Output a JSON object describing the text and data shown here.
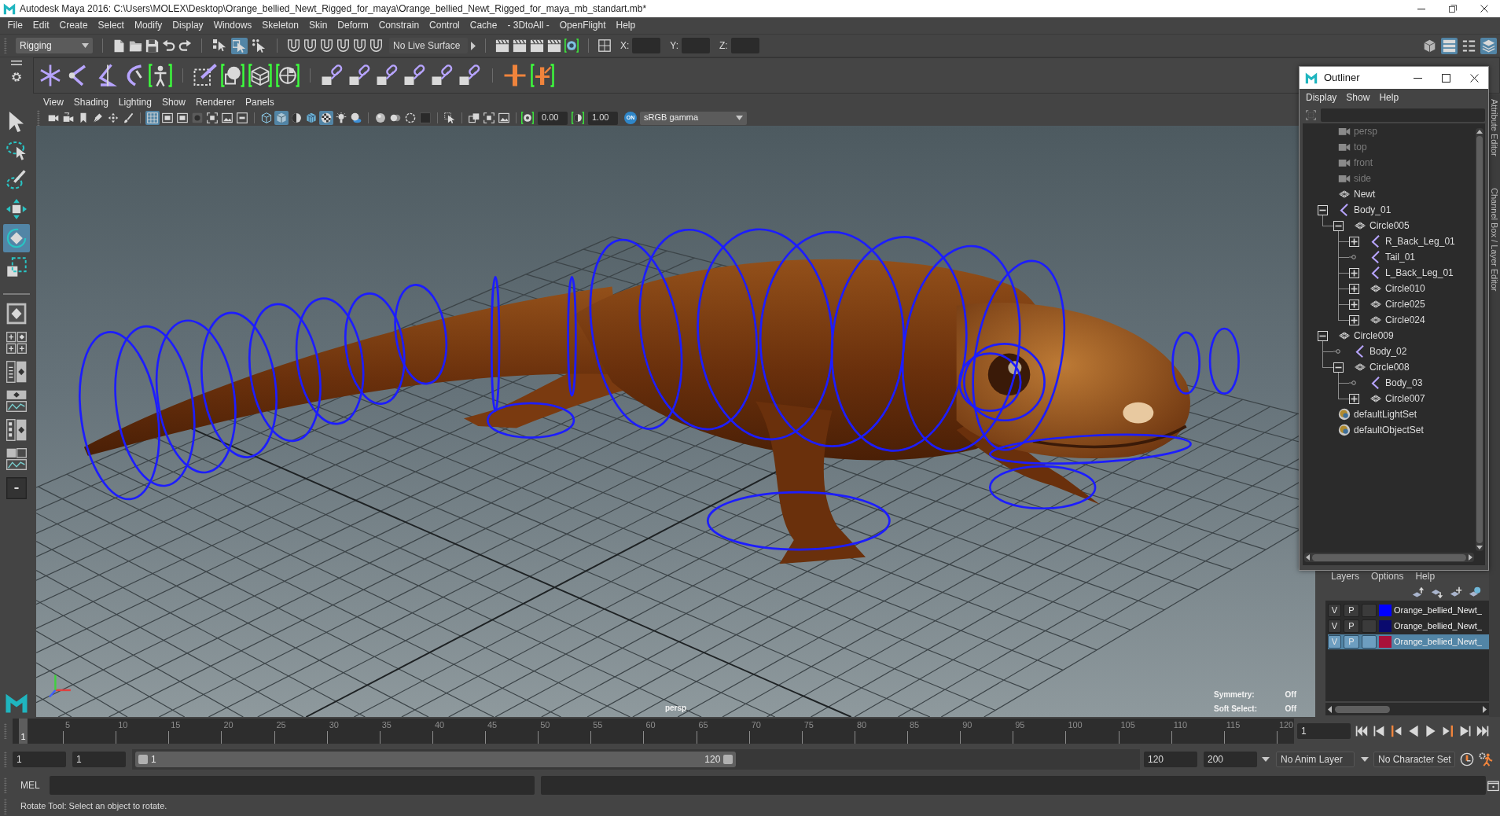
{
  "window": {
    "title": "Autodesk Maya 2016: C:\\Users\\MOLEX\\Desktop\\Orange_bellied_Newt_Rigged_for_maya\\Orange_bellied_Newt_Rigged_for_maya_mb_standart.mb*"
  },
  "menu_bar": [
    "File",
    "Edit",
    "Create",
    "Select",
    "Modify",
    "Display",
    "Windows",
    "Skeleton",
    "Skin",
    "Deform",
    "Constrain",
    "Control",
    "Cache",
    "- 3DtoAll -",
    "OpenFlight",
    "Help"
  ],
  "status_line": {
    "menu_set": "Rigging",
    "select_modes": [
      {
        "selected": false
      },
      {
        "selected": true
      },
      {
        "selected": false
      }
    ],
    "live_surface": "No Live Surface",
    "coordinate_fields": [
      {
        "label": "X:"
      },
      {
        "label": "Y:"
      },
      {
        "label": "Z:"
      }
    ],
    "panel_toggles": [
      {
        "on": false
      },
      {
        "on": true
      },
      {
        "on": false
      },
      {
        "on": true
      }
    ]
  },
  "tool_box": {
    "tools": [
      {
        "selected": false
      },
      {
        "selected": false
      },
      {
        "selected": false
      },
      {
        "selected": false
      },
      {
        "selected": true
      },
      {
        "selected": false
      }
    ]
  },
  "viewport": {
    "menus": [
      "View",
      "Shading",
      "Lighting",
      "Show",
      "Renderer",
      "Panels"
    ],
    "display_toggles": [
      {
        "on": false
      },
      {
        "on": false
      },
      {
        "on": false
      },
      {
        "on": false
      },
      {
        "on": false
      },
      {
        "on": false
      },
      {
        "on": true
      },
      {
        "on": false
      },
      {
        "on": false
      },
      {
        "on": false
      },
      {
        "on": false
      },
      {
        "on": false
      },
      {
        "on": false
      },
      {
        "on": false
      },
      {
        "on": true
      },
      {
        "on": false
      },
      {
        "on": false
      },
      {
        "on": true
      },
      {
        "on": false
      },
      {
        "on": false
      },
      {
        "on": false
      },
      {
        "on": false
      },
      {
        "on": false
      },
      {
        "on": false
      },
      {
        "on": false
      },
      {
        "on": false
      },
      {
        "on": false
      },
      {
        "on": false
      }
    ],
    "exposure": "0.00",
    "gamma": "1.00",
    "color_management": "ON",
    "color_space": "sRGB gamma",
    "camera": "persp",
    "hud": [
      {
        "label": "Symmetry:",
        "value": "Off"
      },
      {
        "label": "Soft Select:",
        "value": "Off"
      }
    ]
  },
  "outliner": {
    "title": "Outliner",
    "menus": [
      "Display",
      "Show",
      "Help"
    ],
    "items": [
      {
        "name": "persp",
        "kind": "camera",
        "hidden": true,
        "expandable": false
      },
      {
        "name": "top",
        "kind": "camera",
        "hidden": true,
        "expandable": false
      },
      {
        "name": "front",
        "kind": "camera",
        "hidden": true,
        "expandable": false
      },
      {
        "name": "side",
        "kind": "camera",
        "hidden": true,
        "expandable": false
      },
      {
        "name": "Newt",
        "kind": "transform",
        "hidden": false,
        "expandable": false
      },
      {
        "name": "Body_01",
        "kind": "joint",
        "hidden": false,
        "expandable": true,
        "expanded": true,
        "children": [
          {
            "name": "Circle005",
            "kind": "transform",
            "hidden": false,
            "expandable": true,
            "expanded": true,
            "children": [
              {
                "name": "R_Back_Leg_01",
                "kind": "joint",
                "hidden": false,
                "expandable": true,
                "expanded": false
              },
              {
                "name": "Tail_01",
                "kind": "joint",
                "hidden": false,
                "expandable": false
              },
              {
                "name": "L_Back_Leg_01",
                "kind": "joint",
                "hidden": false,
                "expandable": true,
                "expanded": false
              },
              {
                "name": "Circle010",
                "kind": "transform",
                "hidden": false,
                "expandable": true,
                "expanded": false
              },
              {
                "name": "Circle025",
                "kind": "transform",
                "hidden": false,
                "expandable": true,
                "expanded": false
              },
              {
                "name": "Circle024",
                "kind": "transform",
                "hidden": false,
                "expandable": true,
                "expanded": false
              }
            ]
          }
        ]
      },
      {
        "name": "Circle009",
        "kind": "transform",
        "hidden": false,
        "expandable": true,
        "expanded": true,
        "children": [
          {
            "name": "Body_02",
            "kind": "joint",
            "hidden": false,
            "expandable": false
          },
          {
            "name": "Circle008",
            "kind": "transform",
            "hidden": false,
            "expandable": true,
            "expanded": true,
            "children": [
              {
                "name": "Body_03",
                "kind": "joint",
                "hidden": false,
                "expandable": false
              },
              {
                "name": "Circle007",
                "kind": "transform",
                "hidden": false,
                "expandable": true,
                "expanded": false
              }
            ]
          }
        ]
      },
      {
        "name": "defaultLightSet",
        "kind": "set",
        "hidden": false,
        "expandable": false
      },
      {
        "name": "defaultObjectSet",
        "kind": "set",
        "hidden": false,
        "expandable": false
      }
    ]
  },
  "side_tabs": [
    "Attribute Editor",
    "Channel Box / Layer Editor"
  ],
  "layer_editor": {
    "menus": [
      "Layers",
      "Options",
      "Help"
    ],
    "layers": [
      {
        "visibility": "V",
        "playback": "P",
        "name": "Orange_bellied_Newt_",
        "color": "#0000ff",
        "selected": false
      },
      {
        "visibility": "V",
        "playback": "P",
        "name": "Orange_bellied_Newt_",
        "color": "#0a0a6e",
        "selected": false
      },
      {
        "visibility": "V",
        "playback": "P",
        "name": "Orange_bellied_Newt_",
        "color": "#a8113a",
        "selected": true
      }
    ]
  },
  "time_slider": {
    "current_frame": "1",
    "level": 0,
    "ticks": [
      "5",
      "10",
      "15",
      "20",
      "25",
      "30",
      "35",
      "40",
      "45",
      "50",
      "55",
      "60",
      "65",
      "70",
      "75",
      "80",
      "85",
      "90",
      "95",
      "100",
      "105",
      "110",
      "115",
      "120"
    ],
    "frame_field": "1"
  },
  "range_slider": {
    "start": "1",
    "playback_start": "1",
    "range_start": "1",
    "range_end": "120",
    "level": 0.6,
    "playback_end": "120",
    "end": "200",
    "anim_layer": "No Anim Layer",
    "character_set": "No Character Set"
  },
  "command_line": {
    "language": "MEL"
  },
  "help_line": "Rotate Tool: Select an object to rotate."
}
